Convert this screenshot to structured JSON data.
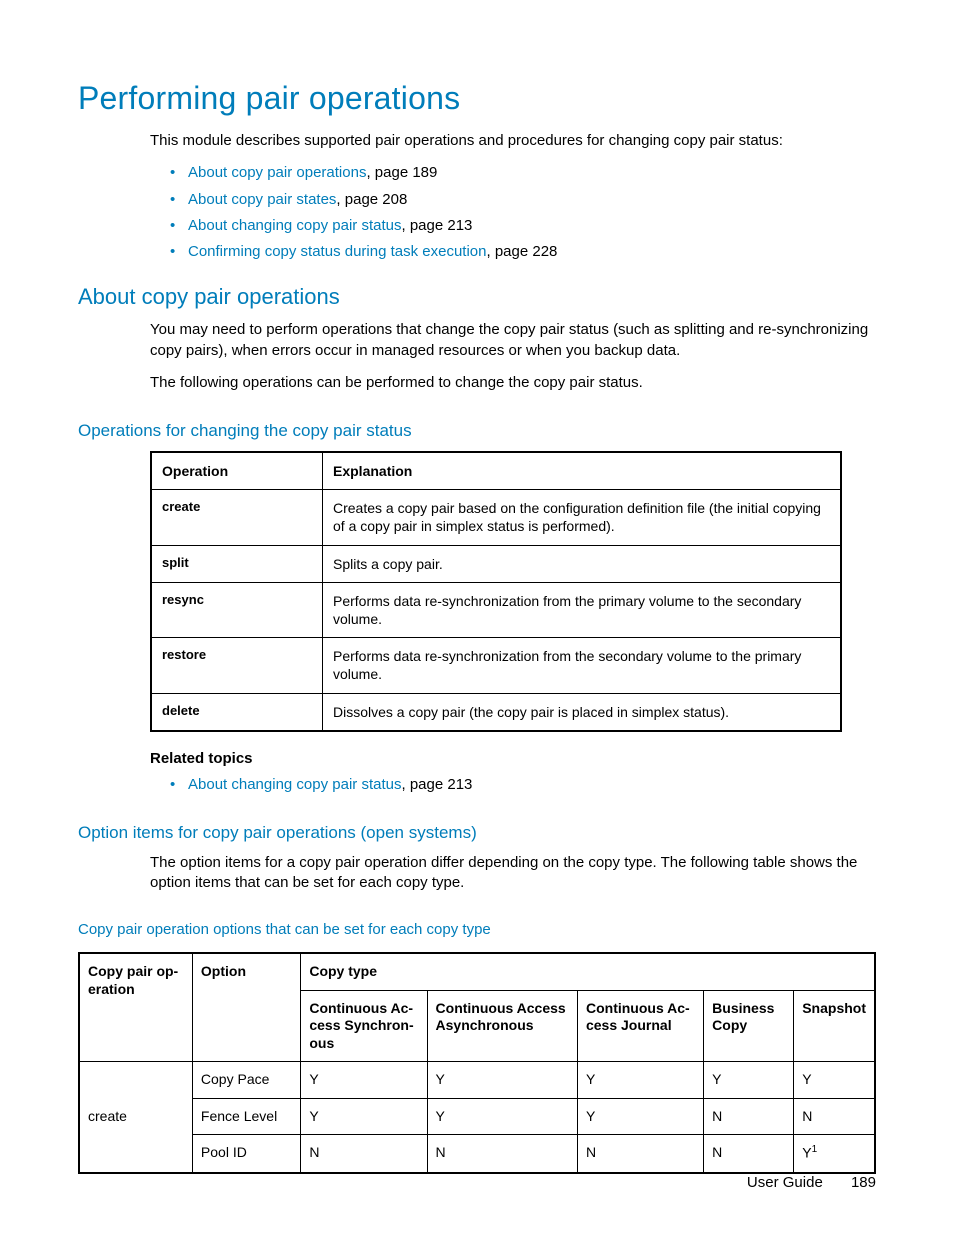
{
  "title": "Performing pair operations",
  "intro": "This module describes supported pair operations and procedures for changing copy pair status:",
  "toc": [
    {
      "link": "About copy pair operations",
      "suffix": ", page 189"
    },
    {
      "link": "About copy pair states",
      "suffix": ", page 208"
    },
    {
      "link": "About changing copy pair status",
      "suffix": ", page 213"
    },
    {
      "link": "Confirming copy status during task execution",
      "suffix": ", page 228"
    }
  ],
  "section1": {
    "heading": "About copy pair operations",
    "p1": "You may need to perform operations that change the copy pair status (such as splitting and re-synchronizing copy pairs), when errors occur in managed resources or when you backup data.",
    "p2": "The following operations can be performed to change the copy pair status."
  },
  "table1": {
    "heading": "Operations for changing the copy pair status",
    "head": {
      "c1": "Operation",
      "c2": "Explanation"
    },
    "rows": [
      {
        "op": "create",
        "exp": "Creates a copy pair based on the configuration definition file (the initial copying of a copy pair in simplex status is performed)."
      },
      {
        "op": "split",
        "exp": "Splits a copy pair."
      },
      {
        "op": "resync",
        "exp": "Performs data re-synchronization from the primary volume to the secondary volume."
      },
      {
        "op": "restore",
        "exp": "Performs data re-synchronization from the secondary volume to the primary volume."
      },
      {
        "op": "delete",
        "exp": "Dissolves a copy pair (the copy pair is placed in simplex status)."
      }
    ]
  },
  "related": {
    "title": "Related topics",
    "items": [
      {
        "link": "About changing copy pair status",
        "suffix": ", page 213"
      }
    ]
  },
  "section2": {
    "heading": "Option items for copy pair operations (open systems)",
    "p1": "The option items for a copy pair operation differ depending on the copy type. The following table shows the option items that can be set for each copy type."
  },
  "table2": {
    "heading": "Copy pair operation options that can be set for each copy type",
    "head": {
      "copyop": "Copy pair op-\neration",
      "option": "Option",
      "copytype": "Copy type",
      "ct1": "Continuous Ac-\ncess Synchron-\nous",
      "ct2": "Continuous Access Asynchronous",
      "ct3": "Continuous Ac-\ncess Journal",
      "ct4": "Business Copy",
      "ct5": "Snapshot"
    },
    "group_op": "create",
    "rows": [
      {
        "option": "Copy Pace",
        "v1": "Y",
        "v2": "Y",
        "v3": "Y",
        "v4": "Y",
        "v5": "Y"
      },
      {
        "option": "Fence Level",
        "v1": "Y",
        "v2": "Y",
        "v3": "Y",
        "v4": "N",
        "v5": "N"
      },
      {
        "option": "Pool ID",
        "v1": "N",
        "v2": "N",
        "v3": "N",
        "v4": "N",
        "v5": "Y",
        "v5_sup": "1"
      }
    ]
  },
  "footer": {
    "label": "User Guide",
    "page": "189"
  }
}
